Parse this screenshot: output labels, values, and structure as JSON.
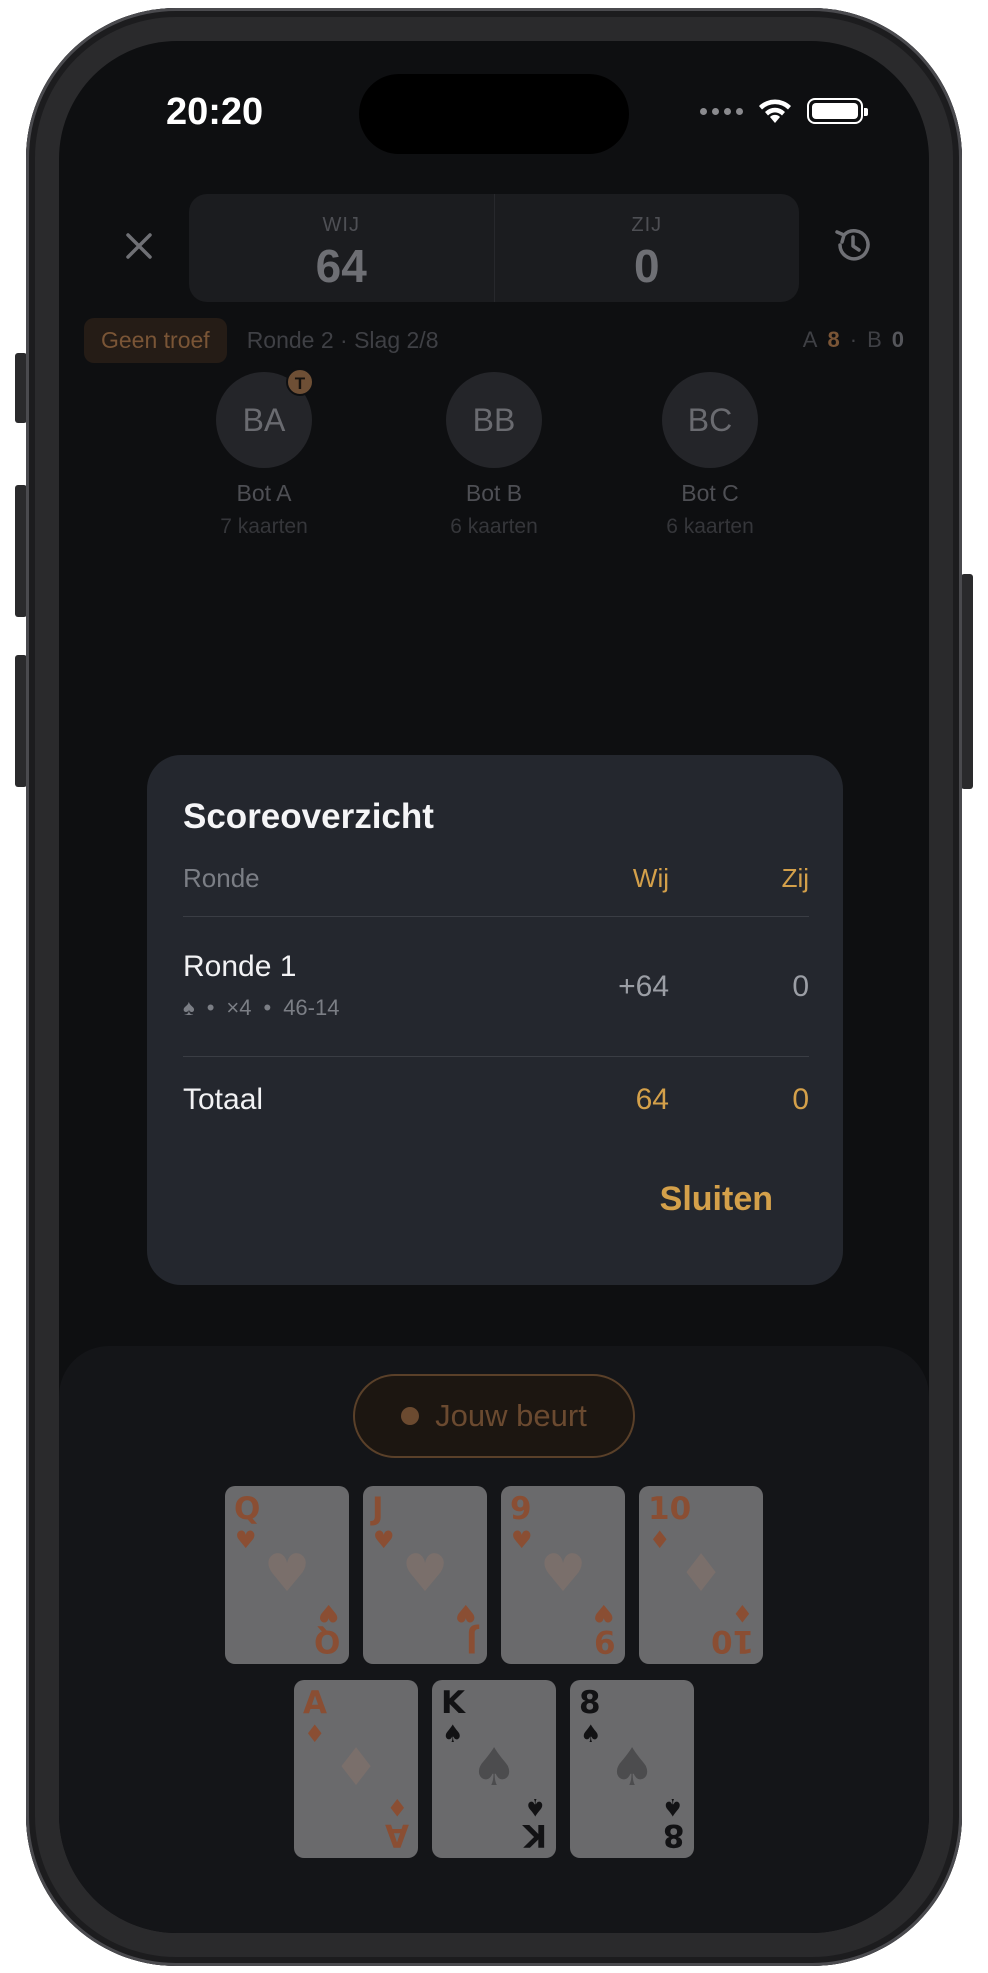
{
  "status_bar": {
    "time": "20:20"
  },
  "header": {
    "team_us_label": "WIJ",
    "team_us_score": "64",
    "team_them_label": "ZIJ",
    "team_them_score": "0"
  },
  "info_bar": {
    "trump_label": "Geen troef",
    "round_info": "Ronde 2 · Slag 2/8",
    "team_a_label": "A",
    "team_a_value": "8",
    "separator": "·",
    "team_b_label": "B",
    "team_b_value": "0"
  },
  "players": [
    {
      "initials": "BA",
      "name": "Bot A",
      "cards": "7 kaarten",
      "badge": "T"
    },
    {
      "initials": "BB",
      "name": "Bot B",
      "cards": "6 kaarten"
    },
    {
      "initials": "BC",
      "name": "Bot C",
      "cards": "6 kaarten"
    }
  ],
  "turn_indicator": "Jouw beurt",
  "hand": [
    {
      "rank": "Q",
      "suit": "♥",
      "color": "red"
    },
    {
      "rank": "J",
      "suit": "♥",
      "color": "red"
    },
    {
      "rank": "9",
      "suit": "♥",
      "color": "red"
    },
    {
      "rank": "10",
      "suit": "♦",
      "color": "red"
    },
    {
      "rank": "A",
      "suit": "♦",
      "color": "red"
    },
    {
      "rank": "K",
      "suit": "♠",
      "color": "black"
    },
    {
      "rank": "8",
      "suit": "♠",
      "color": "black"
    }
  ],
  "modal": {
    "title": "Scoreoverzicht",
    "col_round": "Ronde",
    "col_us": "Wij",
    "col_them": "Zij",
    "rows": [
      {
        "name": "Ronde 1",
        "trump_suit": "♠",
        "dot": "•",
        "multiplier": "×4",
        "points": "46-14",
        "us": "+64",
        "them": "0"
      }
    ],
    "total_label": "Totaal",
    "total_us": "64",
    "total_them": "0",
    "close_label": "Sluiten"
  },
  "colors": {
    "accent": "#d4a04a",
    "modal_bg": "#24272e",
    "screen_bg": "#0e0f11"
  }
}
